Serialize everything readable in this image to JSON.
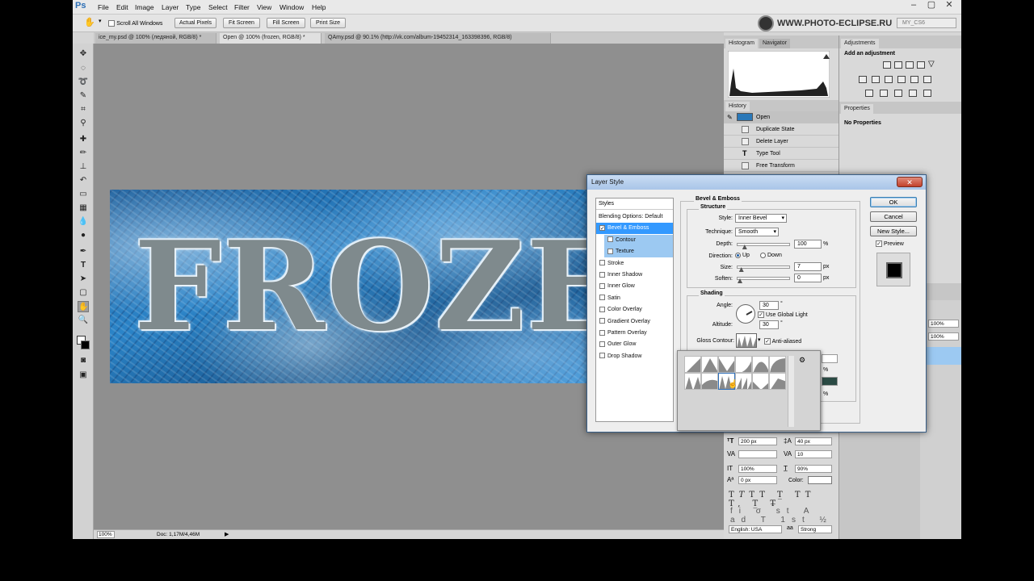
{
  "menu": {
    "logo": "Ps",
    "items": [
      "File",
      "Edit",
      "Image",
      "Layer",
      "Type",
      "Select",
      "Filter",
      "View",
      "Window",
      "Help"
    ],
    "window_controls": [
      "–",
      "▢",
      "✕"
    ]
  },
  "options_bar": {
    "scroll_all_windows": "Scroll All Windows",
    "actual_pixels": "Actual Pixels",
    "fit_screen": "Fit Screen",
    "fill_screen": "Fill Screen",
    "print_size": "Print Size",
    "watermark": "WWW.PHOTO-ECLIPSE.RU",
    "workspace": "MY_CS6"
  },
  "doc_tabs": [
    "ice_my.psd @ 100% (ледяной, RGB/8) *",
    "Open @ 100% (frozen, RGB/8) *",
    "QAmy.psd @ 90.1% (http://vk.com/album-19452314_163398396, RGB/8)"
  ],
  "canvas": {
    "text": "FROZEN"
  },
  "status": {
    "zoom": "100%",
    "doc": "Doc: 1,17M/4,46M"
  },
  "panels": {
    "histogram_tab": "Histogram",
    "navigator_tab": "Navigator",
    "history_tab": "History",
    "history": [
      "Open",
      "Duplicate State",
      "Delete Layer",
      "Type Tool",
      "Free Transform"
    ],
    "adjustments_tab": "Adjustments",
    "add_adjustment": "Add an adjustment",
    "properties_tab": "Properties",
    "no_properties": "No Properties",
    "character": {
      "size": "200 px",
      "leading": "40 px",
      "tracking": "10",
      "vscale": "100%",
      "hscale": "90%",
      "baseline": "0 px",
      "color_label": "Color:",
      "language": "English: USA",
      "aa": "Strong",
      "pct1": "100%",
      "pct2": "100%"
    }
  },
  "dialog": {
    "title": "Layer Style",
    "styles_header": "Styles",
    "styles": [
      {
        "label": "Blending Options: Default",
        "check": false,
        "state": "plain"
      },
      {
        "label": "Bevel & Emboss",
        "check": true,
        "state": "selected"
      },
      {
        "label": "Contour",
        "check": false,
        "state": "sub"
      },
      {
        "label": "Texture",
        "check": false,
        "state": "sub"
      },
      {
        "label": "Stroke",
        "check": false,
        "state": "plain"
      },
      {
        "label": "Inner Shadow",
        "check": false,
        "state": "plain"
      },
      {
        "label": "Inner Glow",
        "check": false,
        "state": "plain"
      },
      {
        "label": "Satin",
        "check": false,
        "state": "plain"
      },
      {
        "label": "Color Overlay",
        "check": false,
        "state": "plain"
      },
      {
        "label": "Gradient Overlay",
        "check": false,
        "state": "plain"
      },
      {
        "label": "Pattern Overlay",
        "check": false,
        "state": "plain"
      },
      {
        "label": "Outer Glow",
        "check": false,
        "state": "plain"
      },
      {
        "label": "Drop Shadow",
        "check": false,
        "state": "plain"
      }
    ],
    "section": "Bevel & Emboss",
    "structure": "Structure",
    "style_label": "Style:",
    "style_value": "Inner Bevel",
    "technique_label": "Technique:",
    "technique_value": "Smooth",
    "depth_label": "Depth:",
    "depth_value": "100",
    "depth_level": 0.1,
    "percent": "%",
    "direction_label": "Direction:",
    "dir_up": "Up",
    "dir_down": "Down",
    "size_label": "Size:",
    "size_value": "7",
    "size_level": 0.03,
    "soften_label": "Soften:",
    "soften_value": "0",
    "soften_level": 0.0,
    "px": "px",
    "shading": "Shading",
    "angle_label": "Angle:",
    "angle_value": "30",
    "degree": "°",
    "use_global": "Use Global Light",
    "altitude_label": "Altitude:",
    "altitude_value": "30",
    "gloss_label": "Gloss Contour:",
    "anti_aliased": "Anti-aliased",
    "ok": "OK",
    "cancel": "Cancel",
    "new_style": "New Style...",
    "preview": "Preview"
  }
}
